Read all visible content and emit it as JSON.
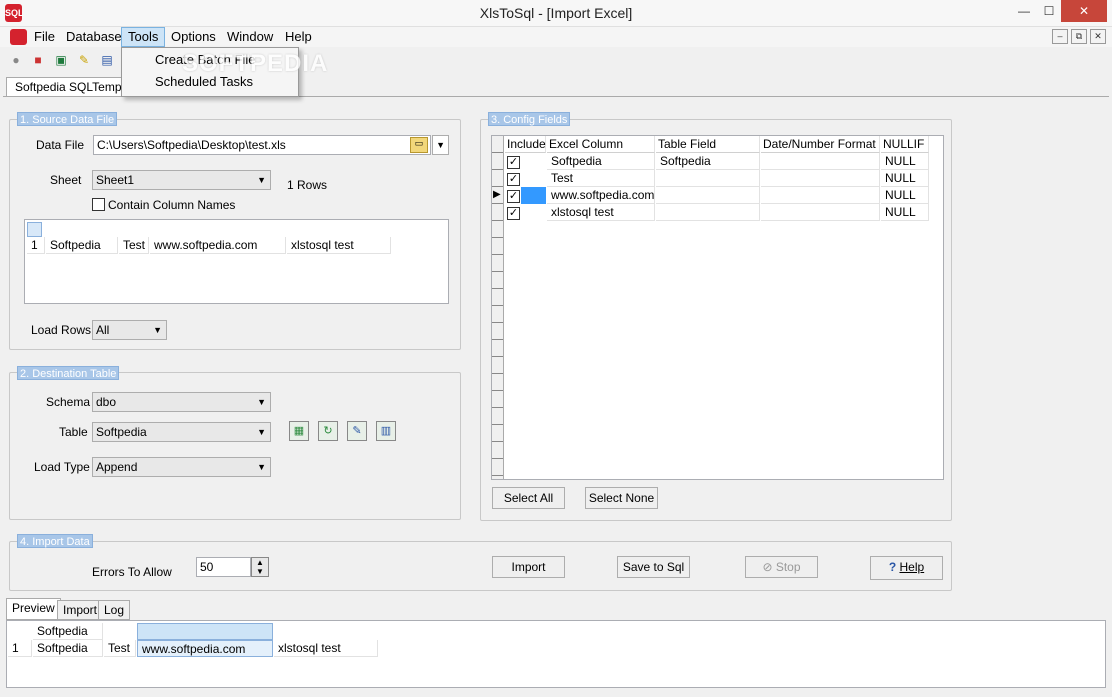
{
  "window": {
    "title": "XlsToSql - [Import Excel]",
    "app_icon": "SQL",
    "minimize": "—",
    "maximize": "☐",
    "close": "✕"
  },
  "menu": {
    "items": [
      "File",
      "Database",
      "Tools",
      "Options",
      "Window",
      "Help"
    ],
    "mdi_buttons": [
      "–",
      "⧉",
      "✕"
    ]
  },
  "tools_menu": {
    "items": [
      "Create Batch File",
      "Scheduled Tasks"
    ]
  },
  "watermark": "SOFTPEDIA",
  "toolbar": {
    "icons": [
      "connect-icon",
      "new-database-icon",
      "excel-icon",
      "wizard-wand-icon",
      "report-icon"
    ]
  },
  "document_tab": "Softpedia SQLTemplate",
  "source": {
    "group_label": "1. Source Data File",
    "data_file_label": "Data File",
    "data_file_value": "C:\\Users\\Softpedia\\Desktop\\test.xls",
    "sheet_label": "Sheet",
    "sheet_value": "Sheet1",
    "rows_text": "1 Rows",
    "contain_column_names": "Contain Column Names",
    "preview_row": [
      "1",
      "Softpedia",
      "Test",
      "www.softpedia.com",
      "xlstosql test"
    ],
    "load_rows_label": "Load Rows",
    "load_rows_value": "All"
  },
  "destination": {
    "group_label": "2. Destination Table",
    "schema_label": "Schema",
    "schema_value": "dbo",
    "table_label": "Table",
    "table_value": "Softpedia",
    "load_type_label": "Load Type",
    "load_type_value": "Append"
  },
  "config": {
    "group_label": "3. Config Fields",
    "headers": [
      "Include",
      "Excel Column",
      "Table Field",
      "Date/Number Format",
      "NULLIF"
    ],
    "rows": [
      {
        "excel": "Softpedia",
        "field": "Softpedia",
        "format": "",
        "nullif": "NULL"
      },
      {
        "excel": "Test",
        "field": "",
        "format": "",
        "nullif": "NULL"
      },
      {
        "excel": "www.softpedia.com",
        "field": "",
        "format": "",
        "nullif": "NULL"
      },
      {
        "excel": "xlstosql test",
        "field": "",
        "format": "",
        "nullif": "NULL"
      }
    ],
    "select_all": "Select All",
    "select_none": "Select None"
  },
  "import": {
    "group_label": "4. Import Data",
    "errors_label": "Errors To Allow",
    "errors_value": "50",
    "import_btn": "Import",
    "save_btn": "Save to Sql",
    "stop_btn": "Stop",
    "help_btn": "Help"
  },
  "bottom_tabs": [
    "Preview",
    "Import",
    "Log"
  ],
  "preview": {
    "header": [
      "Softpedia",
      "",
      ""
    ],
    "row": [
      "1",
      "Softpedia",
      "Test",
      "www.softpedia.com",
      "xlstosql test"
    ]
  }
}
